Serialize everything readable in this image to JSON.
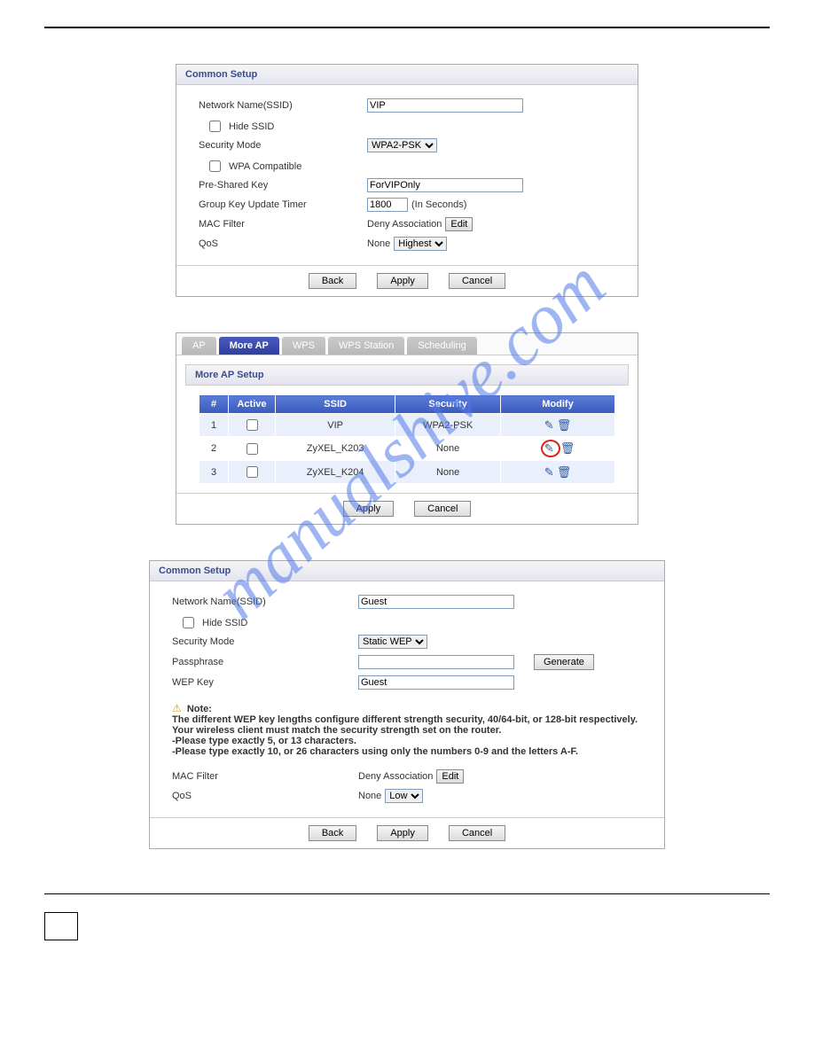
{
  "watermark": "manualshive.com",
  "panel1": {
    "title": "Common Setup",
    "network_name_label": "Network Name(SSID)",
    "network_name_value": "VIP",
    "hide_ssid_label": "Hide SSID",
    "security_mode_label": "Security Mode",
    "security_mode_value": "WPA2-PSK",
    "wpa_compatible_label": "WPA Compatible",
    "psk_label": "Pre-Shared Key",
    "psk_value": "ForVIPOnly",
    "gk_label": "Group Key Update Timer",
    "gk_value": "1800",
    "gk_unit": "(In Seconds)",
    "mac_label": "MAC Filter",
    "mac_text": "Deny Association",
    "edit_btn": "Edit",
    "qos_label": "QoS",
    "qos_text": "None",
    "qos_value": "Highest",
    "back_btn": "Back",
    "apply_btn": "Apply",
    "cancel_btn": "Cancel"
  },
  "panel2": {
    "tabs": {
      "ap": "AP",
      "more_ap": "More AP",
      "wps": "WPS",
      "wps_station": "WPS Station",
      "scheduling": "Scheduling"
    },
    "title": "More AP Setup",
    "headers": {
      "num": "#",
      "active": "Active",
      "ssid": "SSID",
      "security": "Security",
      "modify": "Modify"
    },
    "rows": [
      {
        "num": "1",
        "ssid": "VIP",
        "security": "WPA2-PSK",
        "highlight": false
      },
      {
        "num": "2",
        "ssid": "ZyXEL_K203",
        "security": "None",
        "highlight": true
      },
      {
        "num": "3",
        "ssid": "ZyXEL_K204",
        "security": "None",
        "highlight": false
      }
    ],
    "apply_btn": "Apply",
    "cancel_btn": "Cancel"
  },
  "panel3": {
    "title": "Common Setup",
    "network_name_label": "Network Name(SSID)",
    "network_name_value": "Guest",
    "hide_ssid_label": "Hide SSID",
    "security_mode_label": "Security Mode",
    "security_mode_value": "Static WEP",
    "passphrase_label": "Passphrase",
    "passphrase_value": "",
    "generate_btn": "Generate",
    "wepkey_label": "WEP Key",
    "wepkey_value": "Guest",
    "note_title": "Note:",
    "note_line1": "The different WEP key lengths configure different strength security, 40/64-bit, or 128-bit respectively. Your wireless client must match the security strength set on the router.",
    "note_line2": "-Please type exactly 5, or 13 characters.",
    "note_line3": "-Please type exactly 10, or 26 characters using only the numbers 0-9 and the letters A-F.",
    "mac_label": "MAC Filter",
    "mac_text": "Deny Association",
    "edit_btn": "Edit",
    "qos_label": "QoS",
    "qos_text": "None",
    "qos_value": "Low",
    "back_btn": "Back",
    "apply_btn": "Apply",
    "cancel_btn": "Cancel"
  }
}
